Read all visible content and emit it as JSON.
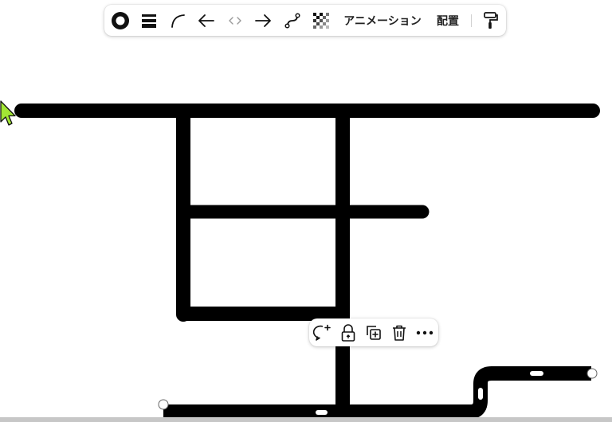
{
  "toolbar": {
    "stroke_color_icon": "filled-circle-icon",
    "stroke_weight_icon": "stroke-weight-icon",
    "curve_icon": "curve-line-icon",
    "arrow_start_icon": "arrow-left-icon",
    "line_end_icon": "code-brackets-icon",
    "arrow_end_icon": "arrow-right-icon",
    "path_icon": "path-connector-icon",
    "transparency_icon": "checkerboard-icon",
    "animation_label": "アニメーション",
    "arrange_label": "配置",
    "paint_icon": "paint-roller-icon"
  },
  "context_menu": {
    "comment_icon": "add-comment-icon",
    "lock_icon": "lock-icon",
    "duplicate_icon": "duplicate-icon",
    "delete_icon": "trash-icon",
    "more_icon": "more-dots-icon"
  },
  "colors": {
    "stroke": "#000000",
    "cursor_fill": "#a3e635",
    "canvas": "#ffffff",
    "bottom_bar": "#c7c7c7"
  }
}
